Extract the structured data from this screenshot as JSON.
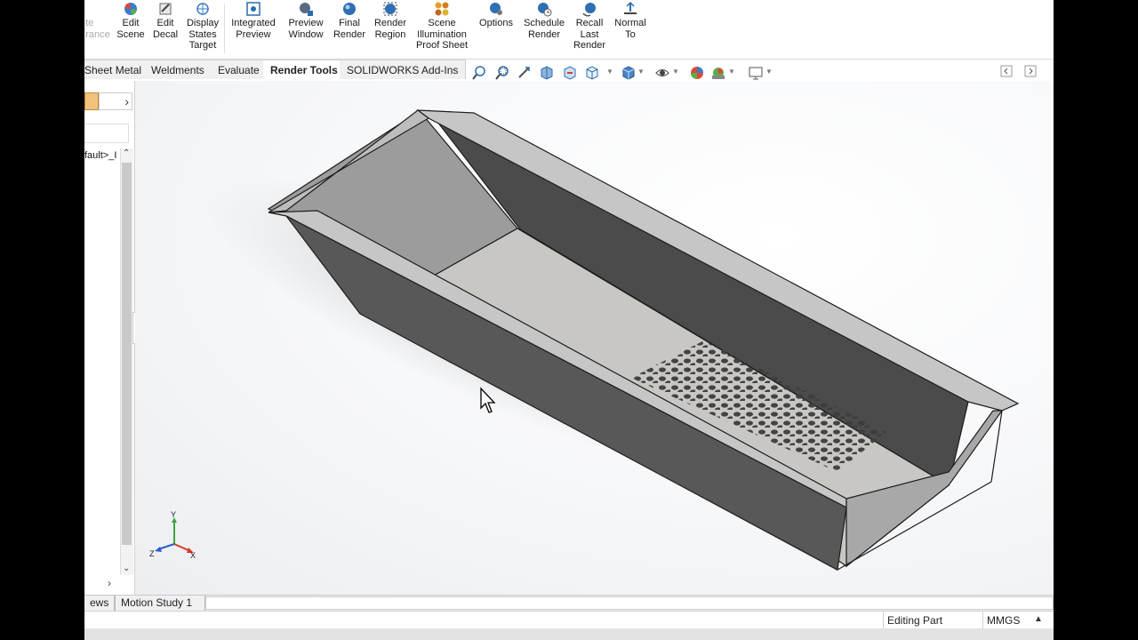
{
  "ribbon": {
    "partial_label": "te\nrance",
    "buttons": [
      {
        "label": "Edit\nScene",
        "icon": "edit-scene-icon"
      },
      {
        "label": "Edit\nDecal",
        "icon": "edit-decal-icon"
      },
      {
        "label": "Display\nStates\nTarget",
        "icon": "display-states-icon"
      },
      {
        "label": "Integrated\nPreview",
        "icon": "integrated-preview-icon"
      },
      {
        "label": "Preview\nWindow",
        "icon": "preview-window-icon"
      },
      {
        "label": "Final\nRender",
        "icon": "final-render-icon"
      },
      {
        "label": "Render\nRegion",
        "icon": "render-region-icon"
      },
      {
        "label": "Scene\nIllumination\nProof Sheet",
        "icon": "scene-illumination-icon"
      },
      {
        "label": "Options",
        "icon": "options-icon"
      },
      {
        "label": "Schedule\nRender",
        "icon": "schedule-render-icon"
      },
      {
        "label": "Recall\nLast\nRender",
        "icon": "recall-render-icon"
      },
      {
        "label": "Normal\nTo",
        "icon": "normal-to-icon"
      }
    ]
  },
  "tabs": [
    {
      "label": "Sheet Metal"
    },
    {
      "label": "Weldments"
    },
    {
      "label": "Evaluate"
    },
    {
      "label": "Render Tools"
    },
    {
      "label": "SOLIDWORKS Add-Ins"
    }
  ],
  "active_tab": "Render Tools",
  "tree": {
    "item": "fault>_I"
  },
  "bottom_tabs": [
    {
      "label": "ews"
    },
    {
      "label": "Motion Study 1"
    }
  ],
  "status": {
    "mode": "Editing Part",
    "units": "MMGS"
  },
  "triad": {
    "x": "X",
    "y": "Y",
    "z": "Z"
  },
  "colors": {
    "accent": "#2b6cb0",
    "part": "#5a5a5a",
    "background": "#f4f6f8"
  }
}
